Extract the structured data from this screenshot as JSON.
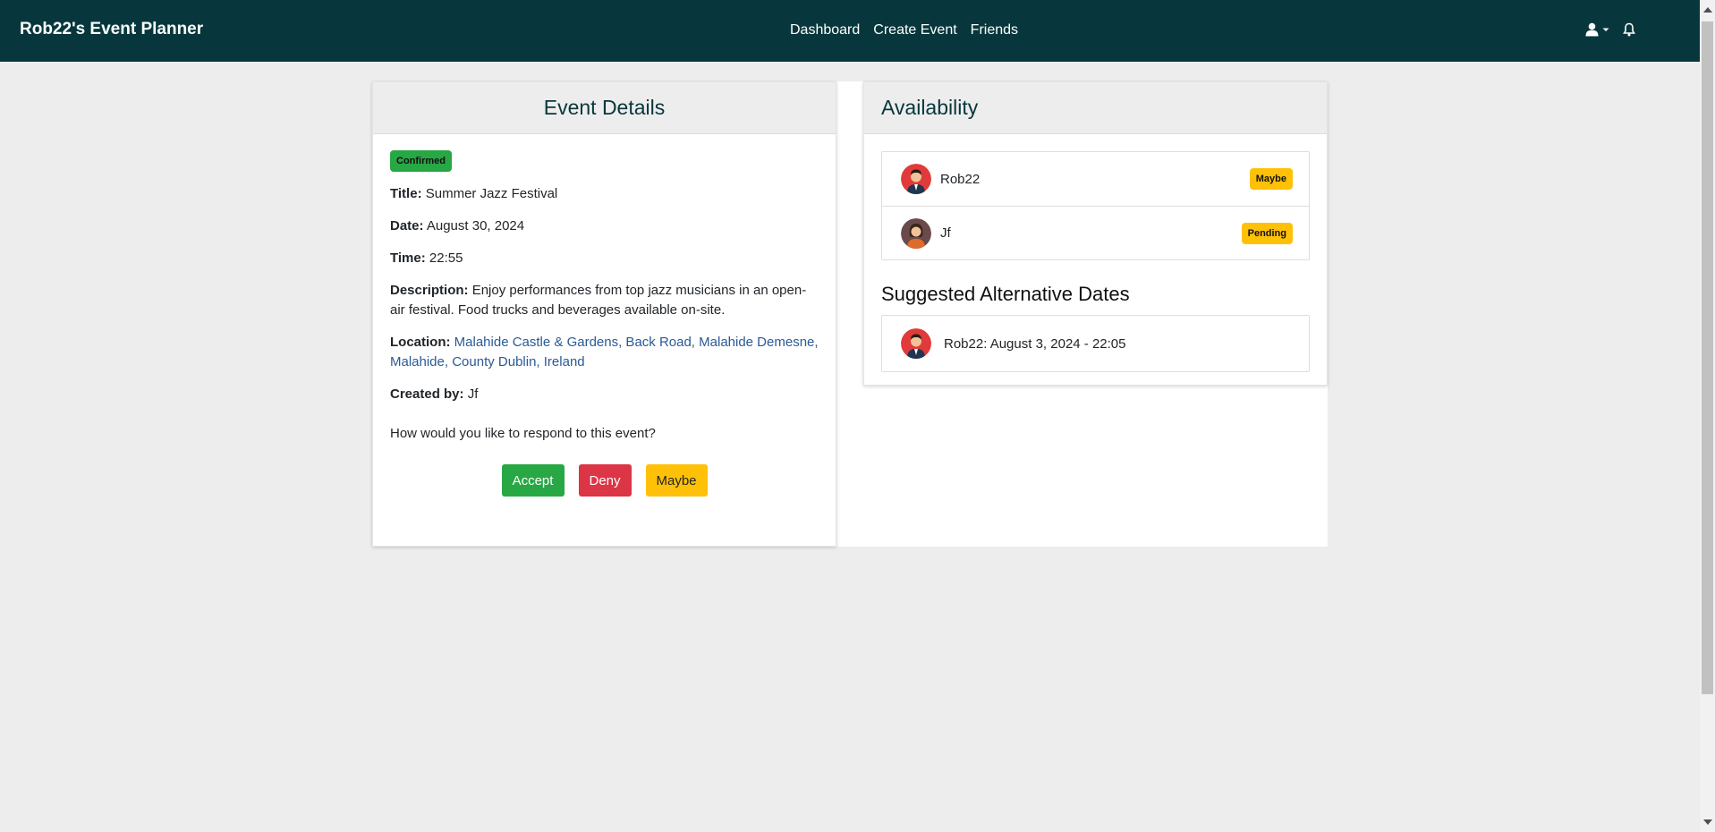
{
  "navbar": {
    "brand": "Rob22's Event Planner",
    "links": [
      {
        "label": "Dashboard"
      },
      {
        "label": "Create Event"
      },
      {
        "label": "Friends"
      }
    ],
    "icons": [
      "user-icon",
      "chevron-down-icon",
      "bell-icon"
    ],
    "background": "#07373c"
  },
  "event": {
    "header": "Event Details",
    "status": "Confirmed",
    "title_label": "Title:",
    "title": "Summer Jazz Festival",
    "date_label": "Date:",
    "date": "August 30, 2024",
    "time_label": "Time:",
    "time": "22:55",
    "description_label": "Description:",
    "description": "Enjoy performances from top jazz musicians in an open-air festival. Food trucks and beverages available on-site.",
    "location_label": "Location:",
    "location": "Malahide Castle & Gardens, Back Road, Malahide Demesne, Malahide, County Dublin, Ireland",
    "created_by_label": "Created by:",
    "created_by": "Jf",
    "prompt": "How would you like to respond to this event?",
    "buttons": {
      "accept": "Accept",
      "deny": "Deny",
      "maybe": "Maybe"
    }
  },
  "availability": {
    "header": "Availability",
    "attendees": [
      {
        "name": "Rob22",
        "status": "Maybe"
      },
      {
        "name": "Jf",
        "status": "Pending"
      }
    ],
    "alt_title": "Suggested Alternative Dates",
    "alternatives": [
      {
        "text": "Rob22: August 3, 2024 - 22:05"
      }
    ]
  },
  "colors": {
    "success": "#28a745",
    "danger": "#dc3545",
    "warning": "#ffc107",
    "link": "#2a5a96"
  }
}
